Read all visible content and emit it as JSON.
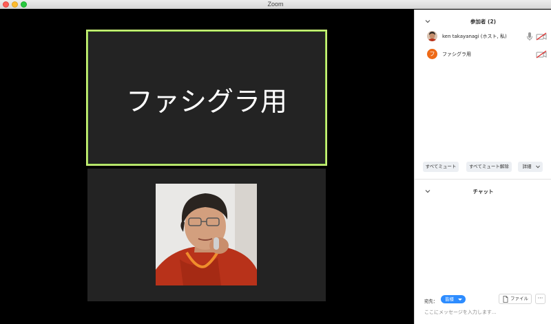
{
  "window": {
    "title": "Zoom"
  },
  "video": {
    "active_speaker_name": "ファシグラ用"
  },
  "participants": {
    "header": "参加者 (2)",
    "list": [
      {
        "name": "ken takayanagi (ホスト, 私)",
        "avatar": "photo",
        "mic": "mic-icon",
        "video": "video-off-icon"
      },
      {
        "name": "ファシグラ用",
        "avatar_letter": "フ",
        "avatar_color": "#ee6a17",
        "video": "video-off-icon"
      }
    ],
    "buttons": {
      "mute_all": "すべてミュート",
      "unmute_all": "すべてミュート解除",
      "more": "詳細"
    }
  },
  "chat": {
    "header": "チャット",
    "to_label": "宛先：",
    "to_value": "皆様",
    "file_button": "ファイル",
    "more_button": "···",
    "input_placeholder": "ここにメッセージを入力します..."
  },
  "colors": {
    "active_border": "#c9f078",
    "accent_blue": "#2d8cff",
    "avatar_orange": "#ee6a17",
    "video_bg": "#232323"
  }
}
